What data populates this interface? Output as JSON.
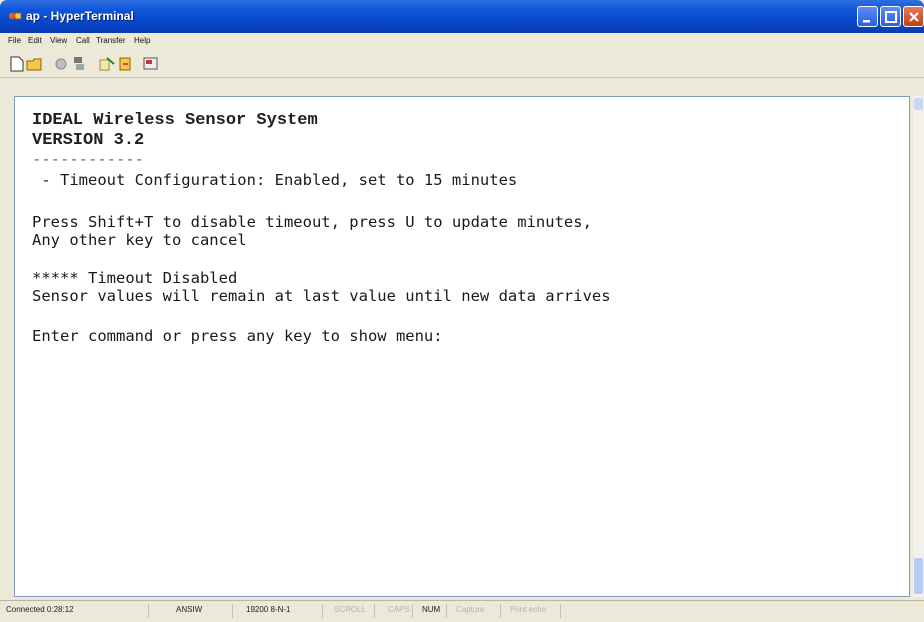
{
  "window": {
    "title": "ap - HyperTerminal",
    "controls": [
      "minimize-icon",
      "maximize-icon",
      "close-icon"
    ]
  },
  "menubar": {
    "items": [
      "File",
      "Edit",
      "View",
      "Call",
      "Transfer",
      "Help"
    ]
  },
  "toolbar": {
    "icons": [
      "new-icon",
      "open-icon",
      "call-icon",
      "disconnect-icon",
      "send-icon",
      "receive-icon",
      "properties-icon"
    ]
  },
  "terminal": {
    "lines": [
      "IDEAL Wireless Sensor System",
      "VERSION 3.2",
      "------------",
      " - Timeout Configuration: Enabled, set to 15 minutes",
      "Press Shift+T to disable timeout, press U to update minutes,",
      "Any other key to cancel",
      "***** Timeout Disabled",
      "Sensor values will remain at last value until new data arrives",
      "Enter command or press any key to show menu:"
    ]
  },
  "statusbar": {
    "connected": "Connected 0:28:12",
    "emulation": "ANSIW",
    "settings": "19200 8-N-1",
    "scroll": "SCROLL",
    "caps": "CAPS",
    "num": "NUM",
    "capture": "Capture",
    "print_echo": "Print echo"
  },
  "colors": {
    "titlebar": "#0846c8",
    "close_button": "#c1401b",
    "terminal_bg": "#ffffff",
    "window_bg": "#ece9d8"
  }
}
